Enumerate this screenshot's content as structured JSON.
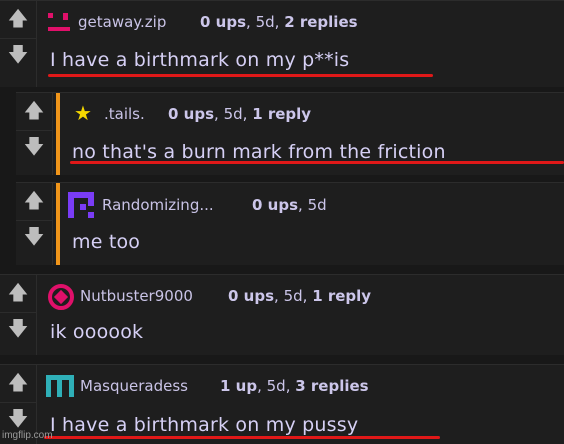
{
  "comments": [
    {
      "username": "getaway.zip",
      "ups": "0 ups",
      "time": "5d",
      "replies": "2 replies",
      "text": "I have a birthmark on my p**is"
    },
    {
      "username": ".tails.",
      "ups": "0 ups",
      "time": "5d",
      "replies": "1 reply",
      "text": "no that's a burn mark from the friction"
    },
    {
      "username": "Randomizing...",
      "ups": "0 ups",
      "time": "5d",
      "text": "me too"
    },
    {
      "username": "Nutbuster9000",
      "ups": "0 ups",
      "time": "5d",
      "replies": "1 reply",
      "text": "ik oooook"
    },
    {
      "username": "Masqueradess",
      "ups": "1 up",
      "time": "5d",
      "replies": "3 replies",
      "text": "I have a birthmark on my pussy"
    }
  ],
  "icons": {
    "upvote": "arrow-up-icon",
    "downvote": "arrow-down-icon"
  },
  "colors": {
    "thread_bar": "#f0951a",
    "underline": "#e01818",
    "background": "#181818"
  },
  "watermark": "imgflip.com"
}
